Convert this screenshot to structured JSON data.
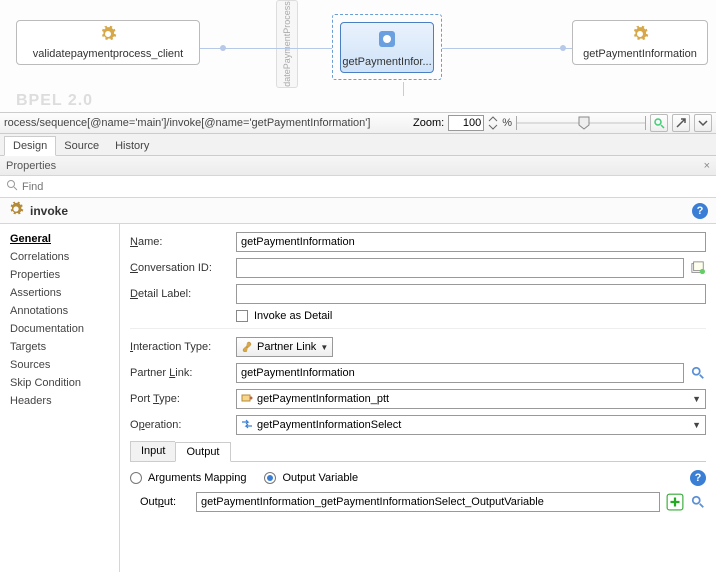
{
  "canvas": {
    "watermark": "BPEL 2.0",
    "vertical_label": "datePaymentProcess",
    "nodes": {
      "left": {
        "label": "validatepaymentprocess_client"
      },
      "mid": {
        "label": "getPaymentInfor..."
      },
      "right": {
        "label": "getPaymentInformation"
      }
    }
  },
  "breadcrumb": "rocess/sequence[@name='main']/invoke[@name='getPaymentInformation']",
  "zoom": {
    "label": "Zoom:",
    "value": "100",
    "pct": "%"
  },
  "tabs": {
    "design": "Design",
    "source": "Source",
    "history": "History"
  },
  "properties_header": "Properties",
  "find_placeholder": "Find",
  "invoke_title": "invoke",
  "side": {
    "items": [
      "General",
      "Correlations",
      "Properties",
      "Assertions",
      "Annotations",
      "Documentation",
      "Targets",
      "Sources",
      "Skip Condition",
      "Headers"
    ]
  },
  "form": {
    "name_label_pre": "N",
    "name_label_post": "ame:",
    "name_value": "getPaymentInformation",
    "cid_label_pre": "C",
    "cid_label_post": "onversation ID:",
    "cid_value": "",
    "detail_label_pre": "D",
    "detail_label_post": "etail Label:",
    "detail_value": "",
    "invoke_as_detail": "Invoke as Detail",
    "interaction_type_label_pre": "I",
    "interaction_type_label_post": "nteraction Type:",
    "interaction_type_value": "Partner Link",
    "partner_link_label_pre": "Partner ",
    "partner_link_label_u": "L",
    "partner_link_label_post": "ink:",
    "partner_link_value": "getPaymentInformation",
    "port_type_label_pre": "Port ",
    "port_type_label_u": "T",
    "port_type_label_post": "ype:",
    "port_type_value": "getPaymentInformation_ptt",
    "operation_label_pre": "O",
    "operation_label_u": "p",
    "operation_label_post": "eration:",
    "operation_value": "getPaymentInformationSelect",
    "subtabs": {
      "input": "Input",
      "output": "Output"
    },
    "arguments_mapping": "Arguments Mapping",
    "output_variable": "Output Variable",
    "output_label_pre": "Out",
    "output_label_u": "p",
    "output_label_post": "ut:",
    "output_value": "getPaymentInformation_getPaymentInformationSelect_OutputVariable"
  }
}
